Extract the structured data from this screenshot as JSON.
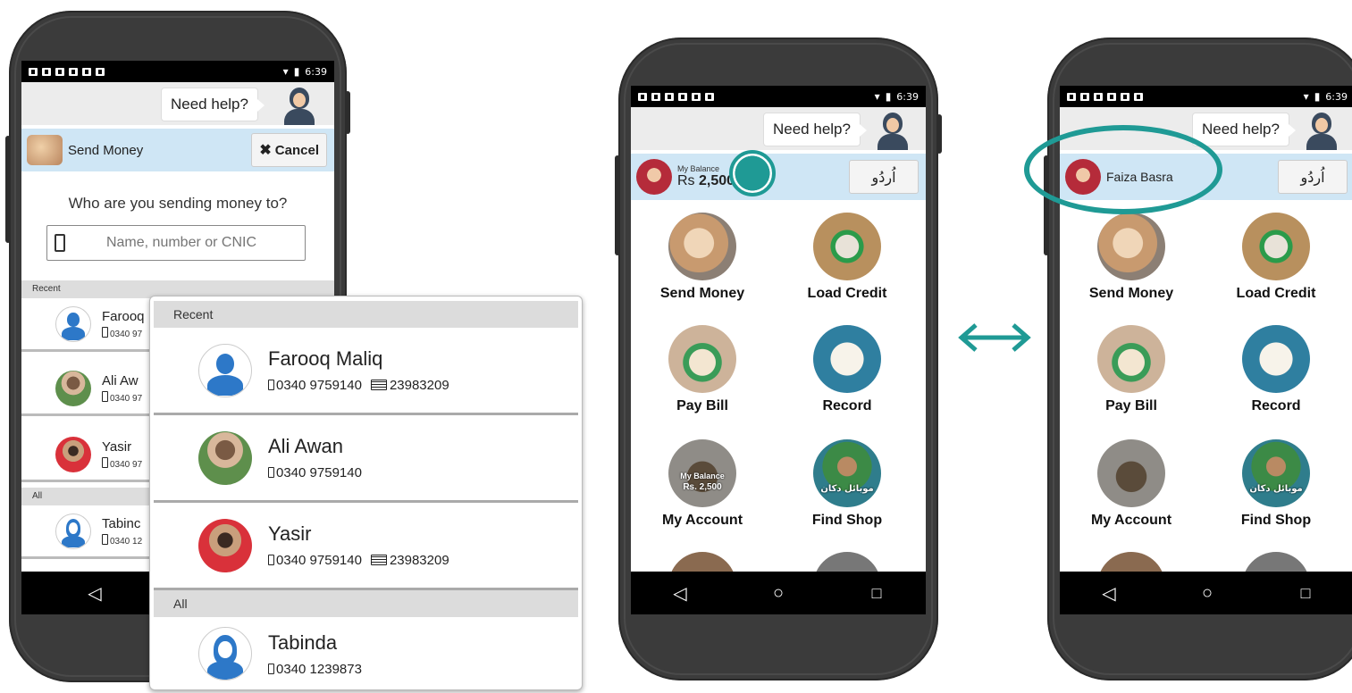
{
  "status_bar": {
    "time": "6:39"
  },
  "help": {
    "label": "Need help?"
  },
  "send_money_screen": {
    "title": "Send Money",
    "cancel_label": "Cancel",
    "question": "Who are you sending money to?",
    "search_placeholder": "Name, number or CNIC",
    "recent_header": "Recent",
    "all_header": "All",
    "contacts_visible": [
      {
        "name": "Farooq",
        "meta": "0340 97"
      },
      {
        "name": "Ali Aw",
        "meta": "0340 97"
      },
      {
        "name": "Yasir",
        "meta": "0340 97"
      },
      {
        "name": "Tabinc",
        "meta": "0340 12"
      }
    ]
  },
  "zoom_panel": {
    "recent_header": "Recent",
    "all_header": "All",
    "contacts": [
      {
        "name": "Farooq Maliq",
        "phone": "0340 9759140",
        "cnic": "23983209",
        "avatar": "default-male-avatar"
      },
      {
        "name": "Ali Awan",
        "phone": "0340 9759140",
        "cnic": "",
        "avatar": "photo-avatar"
      },
      {
        "name": "Yasir",
        "phone": "0340 9759140",
        "cnic": "23983209",
        "avatar": "photo-avatar"
      },
      {
        "name": "Tabinda",
        "phone": "0340 1239873",
        "cnic": "",
        "avatar": "default-female-avatar"
      }
    ]
  },
  "home_before": {
    "balance_label": "My Balance",
    "balance_currency": "Rs",
    "balance_amount": "2,500",
    "language_button": "اُردُو"
  },
  "home_after": {
    "user_name": "Faiza Basra",
    "language_button": "اُردُو"
  },
  "home_tiles": [
    {
      "label": "Send Money",
      "icon": "send-money-icon"
    },
    {
      "label": "Load Credit",
      "icon": "load-credit-icon"
    },
    {
      "label": "Pay Bill",
      "icon": "pay-bill-icon"
    },
    {
      "label": "Record",
      "icon": "record-icon"
    },
    {
      "label": "My Account",
      "icon": "my-account-icon"
    },
    {
      "label": "Find Shop",
      "icon": "find-shop-icon"
    }
  ],
  "tile_overlays": {
    "account_balance_label": "My Balance",
    "account_balance_value": "Rs. 2,500",
    "shop_urdu": "موبائل دکان"
  },
  "colors": {
    "accent": "#1f9a95",
    "header_blue": "#cfe6f5",
    "phone_body": "#3b3b3b"
  }
}
